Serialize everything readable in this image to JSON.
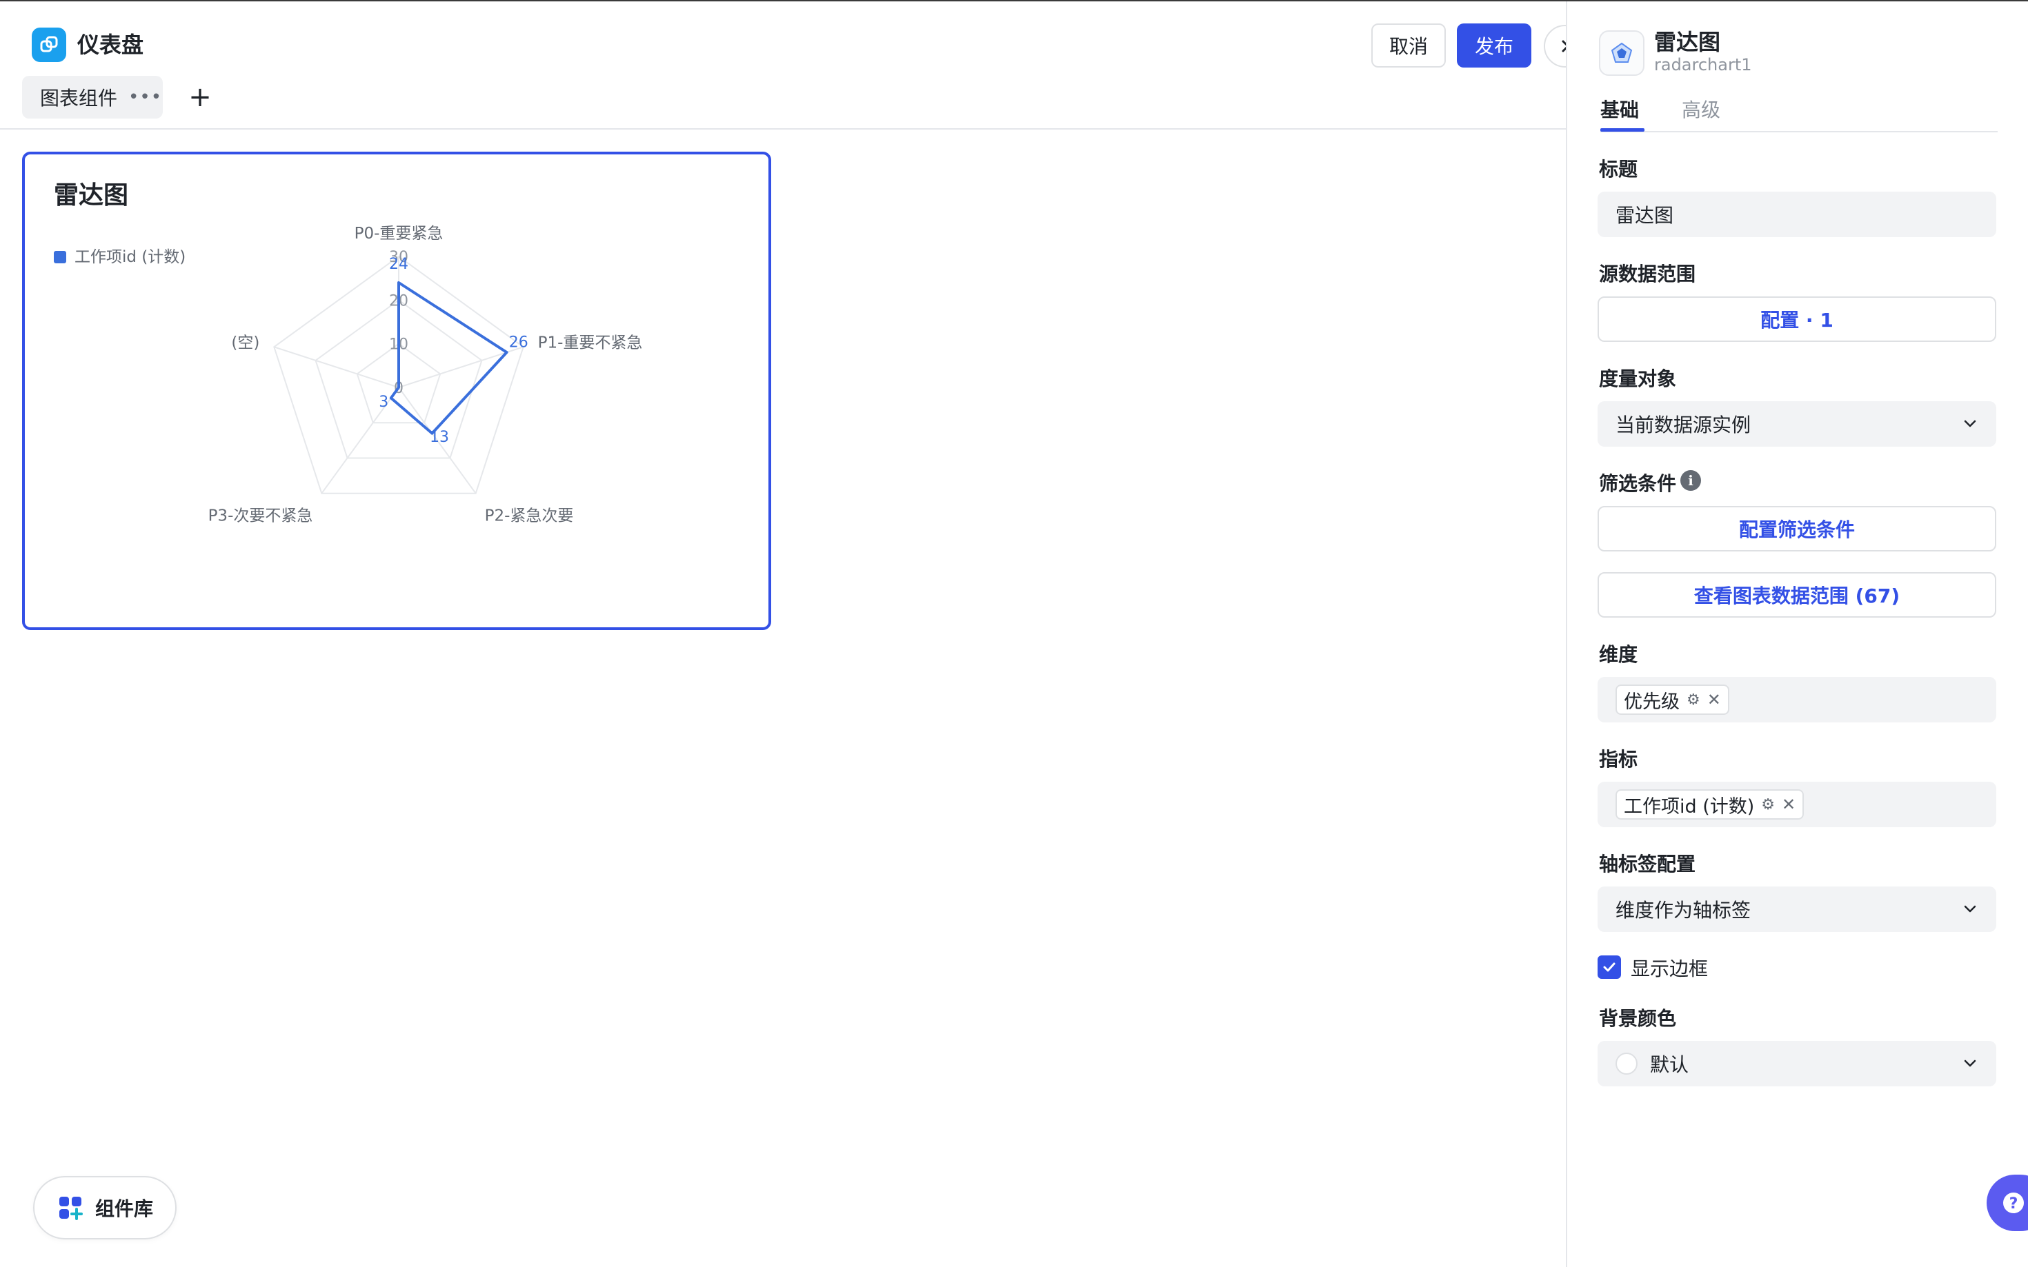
{
  "header": {
    "app_title": "仪表盘",
    "tab_label": "图表组件",
    "tab_more": "•••",
    "add_tab": "+",
    "cancel_label": "取消",
    "publish_label": "发布"
  },
  "card": {
    "title": "雷达图"
  },
  "chart_data": {
    "type": "radar",
    "legend": [
      "工作项id (计数)"
    ],
    "legend_position": "top-left",
    "indicators": [
      "P0-重要紧急",
      "P1-重要不紧急",
      "P2-紧急次要",
      "P3-次要不紧急",
      "(空)"
    ],
    "axis_ticks": [
      "0",
      "10",
      "20",
      "30"
    ],
    "max": 30,
    "series": [
      {
        "name": "工作项id (计数)",
        "values": [
          24,
          26,
          13,
          3,
          0
        ],
        "labels": [
          "24",
          "26",
          "13",
          "3",
          ""
        ]
      }
    ],
    "colors": {
      "series": "#3a6fdc",
      "grid": "#e6e8eb"
    }
  },
  "library": {
    "label": "组件库"
  },
  "panel": {
    "title": "雷达图",
    "subtitle": "radarchart1",
    "tab_basic": "基础",
    "tab_advanced": "高级",
    "title_label": "标题",
    "title_value": "雷达图",
    "source_label": "源数据范围",
    "source_button": "配置 · 1",
    "measure_label": "度量对象",
    "measure_value": "当前数据源实例",
    "filter_label": "筛选条件",
    "filter_button": "配置筛选条件",
    "view_range_button": "查看图表数据范围 (67)",
    "dimension_label": "维度",
    "dimension_tag": "优先级",
    "metric_label": "指标",
    "metric_tag": "工作项id (计数)",
    "axis_label_config": "轴标签配置",
    "axis_label_value": "维度作为轴标签",
    "show_border_label": "显示边框",
    "show_border_checked": true,
    "bg_color_label": "背景颜色",
    "bg_color_value": "默认"
  },
  "colors": {
    "accent": "#3350e6",
    "logo": "#1aa0ee",
    "help": "#5b5bf0"
  }
}
